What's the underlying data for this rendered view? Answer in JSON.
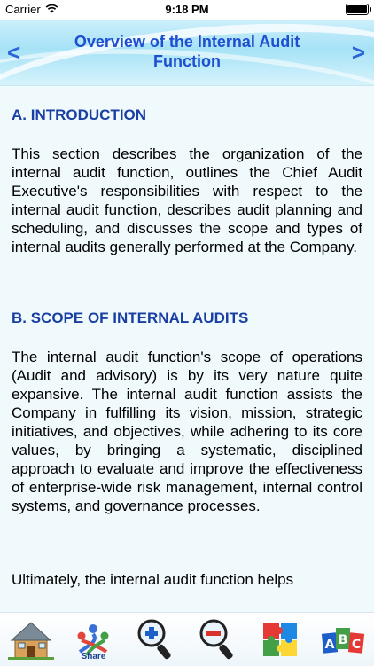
{
  "status_bar": {
    "carrier": "Carrier",
    "time": "9:18 PM"
  },
  "header": {
    "title": "Overview of the Internal Audit Function",
    "prev_icon": "chevron-left-icon",
    "next_icon": "chevron-right-icon"
  },
  "sections": [
    {
      "heading": "A. INTRODUCTION",
      "body": "This section describes the organization of the internal audit function, outlines the Chief Audit Executive's responsibilities with respect to the internal audit function, describes audit planning and scheduling, and discusses the scope and types of internal audits generally performed at the Company."
    },
    {
      "heading": "B. SCOPE OF INTERNAL AUDITS",
      "body": "The internal audit function's scope of operations (Audit and advisory) is by its very nature quite expansive. The internal audit function assists the Company in fulfilling its vision, mission, strategic initiatives, and objectives, while adhering to its core values, by bringing a systematic, disciplined approach to evaluate and improve the effectiveness of enterprise-wide risk management, internal control systems, and governance processes."
    },
    {
      "heading": "",
      "body": "Ultimately, the internal audit function helps"
    }
  ],
  "toolbar": {
    "home_icon": "house-icon",
    "share_label": "Share",
    "share_icon": "share-people-icon",
    "zoom_in_icon": "zoom-in-icon",
    "zoom_out_icon": "zoom-out-icon",
    "puzzle_icon": "puzzle-icon",
    "abc_icon": "abc-blocks-icon"
  }
}
